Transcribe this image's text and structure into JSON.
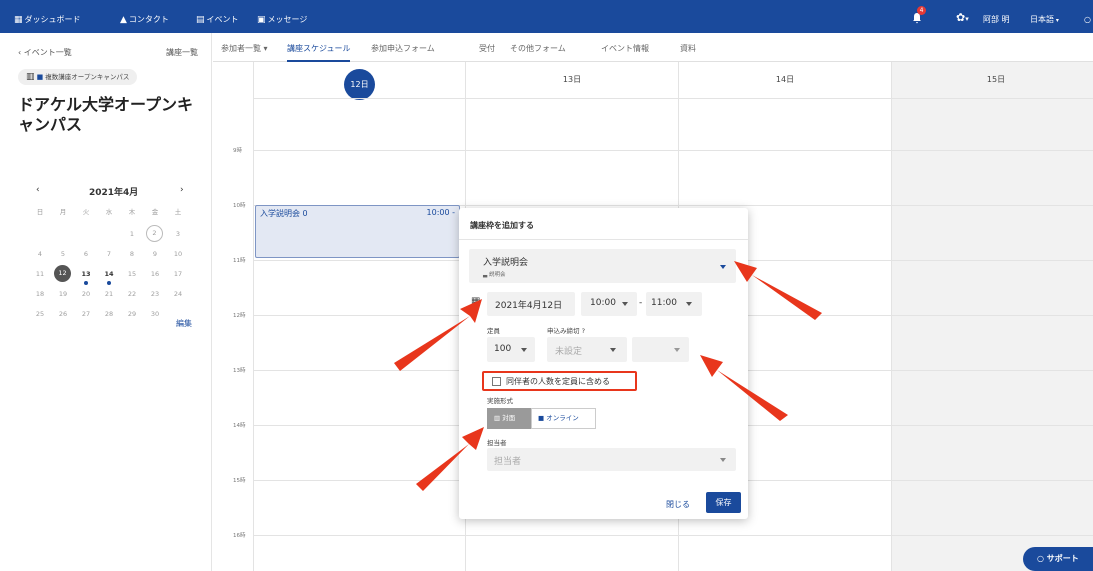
{
  "topnav": {
    "dashboard": "ダッシュボード",
    "contact": "コンタクト",
    "event": "イベント",
    "message": "メッセージ",
    "notification_count": "4",
    "user_name": "阿部 明",
    "language": "日本語"
  },
  "sidebar": {
    "back_link": "‹ イベント一覧",
    "course_list": "講座一覧",
    "chip": "複数講座オープンキャンパス",
    "event_title": "ドアケル大学オープンキャンパス",
    "calendar": {
      "month_label": "2021年4月",
      "weekdays": [
        "日",
        "月",
        "火",
        "水",
        "木",
        "金",
        "土"
      ],
      "days": [
        "1",
        "2",
        "3",
        "4",
        "5",
        "6",
        "7",
        "8",
        "9",
        "10",
        "11",
        "12",
        "13",
        "14",
        "15",
        "16",
        "17",
        "18",
        "19",
        "20",
        "21",
        "22",
        "23",
        "24",
        "25",
        "26",
        "27",
        "28",
        "29",
        "30"
      ]
    },
    "edit_link": "編集"
  },
  "tabs": [
    "参加者一覧 ▾",
    "講座スケジュール",
    "参加申込フォーム",
    "受付",
    "その他フォーム",
    "イベント情報",
    "資料"
  ],
  "schedule": {
    "days": [
      "12日",
      "13日",
      "14日",
      "15日"
    ],
    "hours": [
      "9時",
      "10時",
      "11時",
      "12時",
      "13時",
      "14時",
      "15時",
      "16時"
    ],
    "event_block_title": "入学説明会 0",
    "event_block_time": "10:00 -"
  },
  "modal": {
    "title": "講座枠を追加する",
    "course_name": "入学説明会",
    "course_sub": "説明会",
    "date": "2021年4月12日",
    "start_time": "10:00",
    "end_time": "11:00",
    "time_separator": "-",
    "capacity_label": "定員",
    "deadline_label": "申込み締切",
    "capacity_value": "100",
    "deadline_value": "未設定",
    "companion_checkbox": "同伴者の人数を定員に含める",
    "format_label": "実施形式",
    "format_in_person": "対面",
    "format_online": "オンライン",
    "staff_label": "担当者",
    "staff_placeholder": "担当者",
    "close_button": "閉じる",
    "save_button": "保存"
  },
  "support_button": "サポート",
  "colors": {
    "brand": "#1a4a9c",
    "annotation": "#e8361c"
  }
}
